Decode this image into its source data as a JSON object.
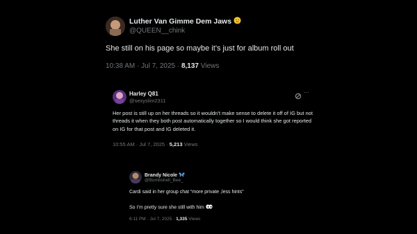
{
  "tweet1": {
    "name": "Luther Van Gimme Dem Jaws",
    "handle": "@QUEEN__chink",
    "text": "She still on his page so maybe it’s just for album roll out",
    "time": "10:38 AM · Jul 7, 2025 ·",
    "views_count": "8,137",
    "views_label": "Views"
  },
  "tweet2": {
    "name": "Harley Q81",
    "handle": "@sexyslim2311",
    "text": "Her post is still up on her threads so it wouldn’t make sense to delete it off of IG but not threads it when they both post automatically together so I would think she got reported on IG for that post and IG deleted it.",
    "time": "10:55 AM · Jul 7, 2025 ·",
    "views_count": "5,213",
    "views_label": "Views",
    "more_label": "···"
  },
  "tweet3": {
    "name": "Brandy Nicole",
    "handle": "@Bombshell_Bee_",
    "text_line1": "Cardi said in her group chat  “more private ,less hints”",
    "text_line2": "So I’m pretty sure she still with him",
    "time": "6:11 PM · Jul 7, 2025 ·",
    "views_count": "1,335",
    "views_label": "Views"
  },
  "icons": [
    "emoji-icon",
    "grok-icon",
    "more-icon",
    "butterfly-icon",
    "eyes-icon"
  ]
}
